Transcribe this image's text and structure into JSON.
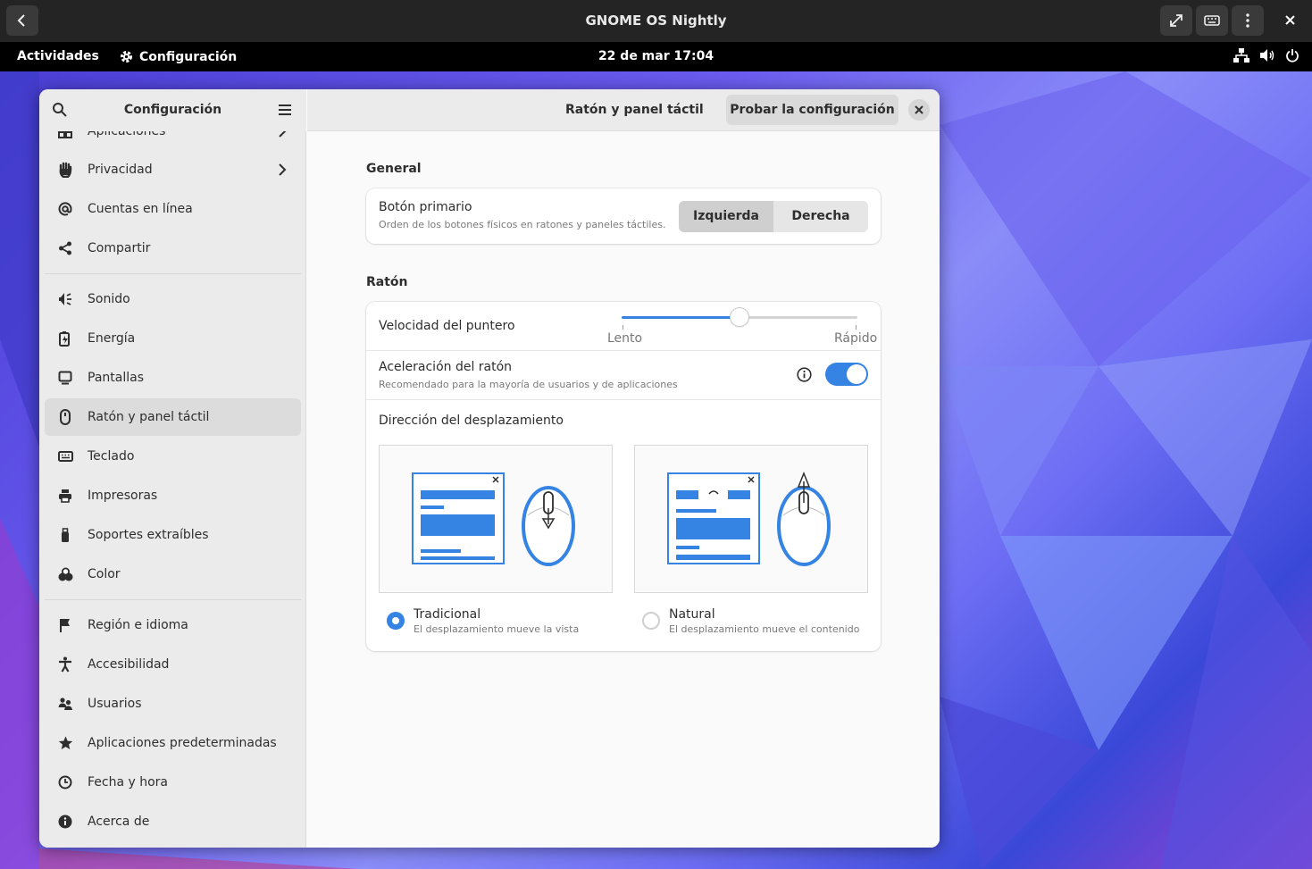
{
  "vm": {
    "title": "GNOME OS Nightly"
  },
  "topbar": {
    "activities": "Actividades",
    "app": "Configuración",
    "clock": "22 de mar  17:04"
  },
  "sidebar": {
    "title": "Configuración",
    "items": [
      {
        "label": "Aplicaciones",
        "icon": "apps-icon"
      },
      {
        "label": "Privacidad",
        "icon": "hand-icon"
      },
      {
        "label": "Cuentas en línea",
        "icon": "at-icon"
      },
      {
        "label": "Compartir",
        "icon": "share-icon"
      },
      {
        "label": "Sonido",
        "icon": "speaker-icon"
      },
      {
        "label": "Energía",
        "icon": "battery-icon"
      },
      {
        "label": "Pantallas",
        "icon": "display-icon"
      },
      {
        "label": "Ratón y panel táctil",
        "icon": "mouse-icon"
      },
      {
        "label": "Teclado",
        "icon": "keyboard-icon"
      },
      {
        "label": "Impresoras",
        "icon": "printer-icon"
      },
      {
        "label": "Soportes extraíbles",
        "icon": "usb-icon"
      },
      {
        "label": "Color",
        "icon": "color-icon"
      },
      {
        "label": "Región e idioma",
        "icon": "flag-icon"
      },
      {
        "label": "Accesibilidad",
        "icon": "accessibility-icon"
      },
      {
        "label": "Usuarios",
        "icon": "users-icon"
      },
      {
        "label": "Aplicaciones predeterminadas",
        "icon": "star-icon"
      },
      {
        "label": "Fecha y hora",
        "icon": "clock-icon"
      },
      {
        "label": "Acerca de",
        "icon": "info-icon"
      }
    ]
  },
  "main": {
    "title": "Ratón y panel táctil",
    "test_button": "Probar la configuración",
    "general": {
      "title": "General",
      "primary_button": {
        "label": "Botón primario",
        "sub": "Orden de los botones físicos en ratones y paneles táctiles.",
        "left": "Izquierda",
        "right": "Derecha",
        "selected": "Izquierda"
      }
    },
    "mouse": {
      "title": "Ratón",
      "speed": {
        "label": "Velocidad del puntero",
        "min_label": "Lento",
        "max_label": "Rápido",
        "value": 0.5
      },
      "accel": {
        "label": "Aceleración del ratón",
        "sub": "Recomendado para la mayoría de usuarios y de aplicaciones",
        "enabled": true
      },
      "scroll": {
        "label": "Dirección del desplazamiento",
        "traditional": {
          "label": "Tradicional",
          "sub": "El desplazamiento mueve la vista",
          "selected": true
        },
        "natural": {
          "label": "Natural",
          "sub": "El desplazamiento mueve el contenido",
          "selected": false
        }
      }
    }
  },
  "colors": {
    "accent": "#3584e4",
    "sidebar_bg": "#ebebeb",
    "window_bg": "#fafafa"
  }
}
